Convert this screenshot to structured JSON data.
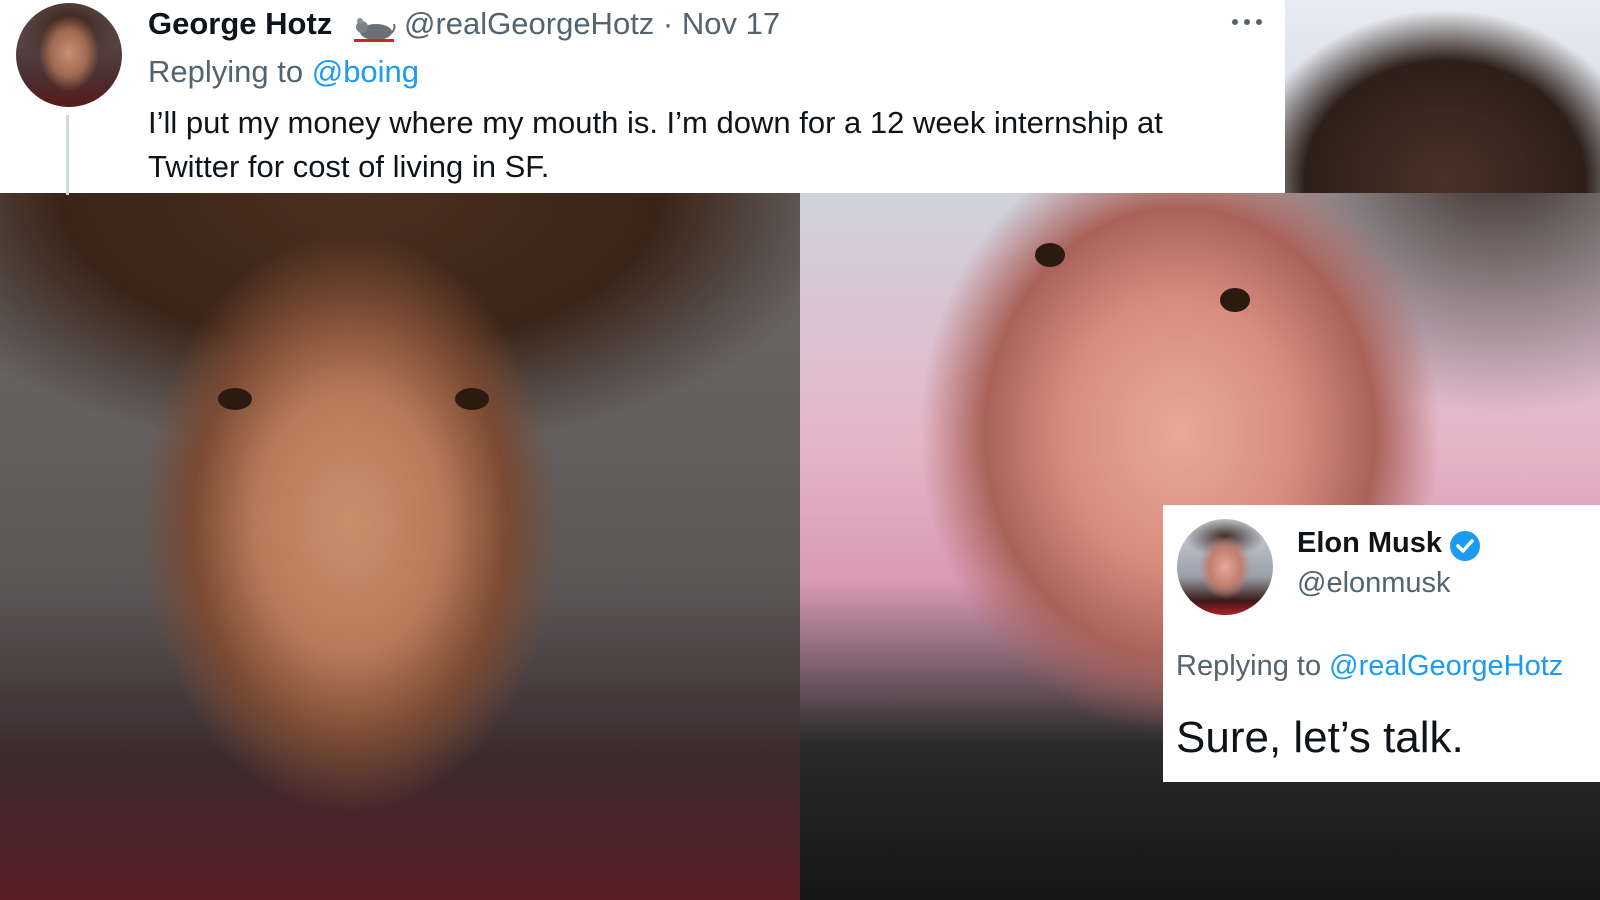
{
  "tweet_hotz": {
    "name": "George Hotz",
    "handle": "@realGeorgeHotz",
    "separator": " · ",
    "date": "Nov 17",
    "replying_prefix": "Replying to ",
    "replying_to": "@boing",
    "text": "I’ll put my money where my mouth is. I’m down for a 12 week internship at Twitter for cost of living in SF.",
    "badge_icon": "rat-icon",
    "menu_icon": "more-icon"
  },
  "tweet_musk": {
    "name": "Elon Musk",
    "handle": "@elonmusk",
    "verified_icon": "verified-badge-icon",
    "replying_prefix": "Replying to ",
    "replying_to": "@realGeorgeHotz",
    "text": "Sure, let’s talk."
  },
  "colors": {
    "link": "#1d9bf0",
    "muted": "#536471",
    "text": "#0f1419",
    "thread_line": "#cfd9de"
  }
}
